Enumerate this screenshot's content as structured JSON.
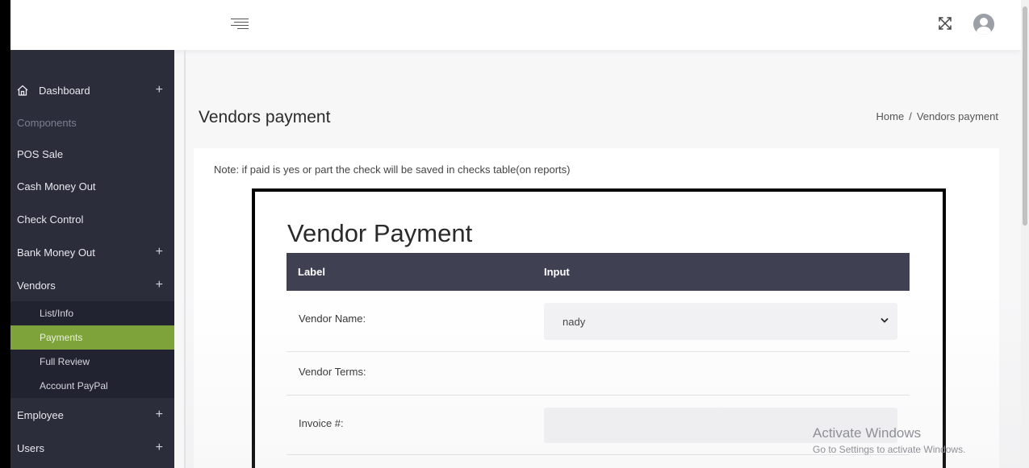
{
  "sidebar": {
    "items": [
      {
        "label": "Dashboard",
        "icon": "house-icon",
        "expandable": true
      },
      {
        "label": "Components"
      },
      {
        "label": "POS Sale"
      },
      {
        "label": "Cash Money Out"
      },
      {
        "label": "Check Control"
      },
      {
        "label": "Bank Money Out",
        "expandable": true
      },
      {
        "label": "Vendors",
        "expandable": true
      },
      {
        "label": "Employee",
        "expandable": true
      },
      {
        "label": "Users",
        "expandable": true
      }
    ],
    "vendors_sub": [
      {
        "label": "List/Info"
      },
      {
        "label": "Payments",
        "active": true
      },
      {
        "label": "Full Review"
      },
      {
        "label": "Account PayPal"
      }
    ],
    "plus": "+",
    "active_color": "#7ea33a"
  },
  "header": {
    "menu_icon": "menu-icon",
    "expand_icon": "fullscreen-icon",
    "avatar_icon": "user-avatar-icon"
  },
  "page": {
    "title": "Vendors payment",
    "breadcrumb": {
      "home": "Home",
      "separator": "/",
      "current": "Vendors payment"
    },
    "note": "Note: if paid is yes or part the check will be saved in checks table(on reports)"
  },
  "form": {
    "title": "Vendor Payment",
    "columns": {
      "label": "Label",
      "input": "Input"
    },
    "rows": [
      {
        "label": "Vendor Name:",
        "value": "nady"
      },
      {
        "label": "Vendor Terms:"
      },
      {
        "label": "Invoice #:",
        "value": ""
      }
    ]
  },
  "watermark": {
    "line1": "Activate Windows",
    "line2": "Go to Settings to activate Windows."
  },
  "colors": {
    "sidebar_bg": "#2b2d3b",
    "table_header_bg": "#3f4153"
  }
}
